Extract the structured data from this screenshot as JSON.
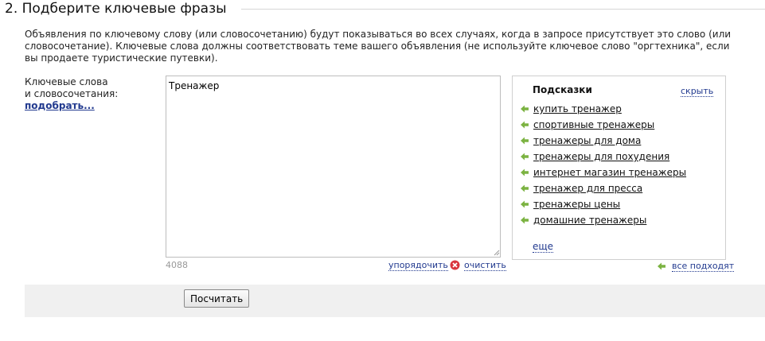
{
  "section": {
    "title": "2. Подберите ключевые фразы"
  },
  "description": "Объявления по ключевому слову (или словосочетанию) будут показываться во всех случаях, когда в запросе присутствует это слово (или словосочетание). Ключевые слова должны соответствовать теме вашего объявления (не используйте ключевое слово \"оргтехника\", если вы продаете туристические путевки).",
  "keywords": {
    "label_line1": "Ключевые слова",
    "label_line2": "и словосочетания:",
    "pick_link": "подобрать...",
    "value": "Тренажер",
    "char_count": "4088",
    "sort_link": "упорядочить",
    "clear_link": "очистить"
  },
  "hints": {
    "title": "Подсказки",
    "hide_link": "скрыть",
    "items": [
      "купить тренажер",
      "спортивные тренажеры",
      "тренажеры для дома",
      "тренажеры для похудения",
      "интернет магазин тренажеры",
      "тренажер для пресса",
      "тренажеры цены",
      "домашние тренажеры"
    ],
    "more_link": "еще",
    "all_fit_link": "все подходят"
  },
  "actions": {
    "calculate_label": "Посчитать"
  },
  "colors": {
    "link": "#223a8f",
    "arrow": "#7cb342",
    "clear_icon": "#d9363e",
    "bar_bg": "#f0f0f0"
  },
  "icons": {
    "hint_arrow": "arrow-left-icon",
    "clear": "close-circle-icon",
    "grip": "resize-grip-icon"
  }
}
